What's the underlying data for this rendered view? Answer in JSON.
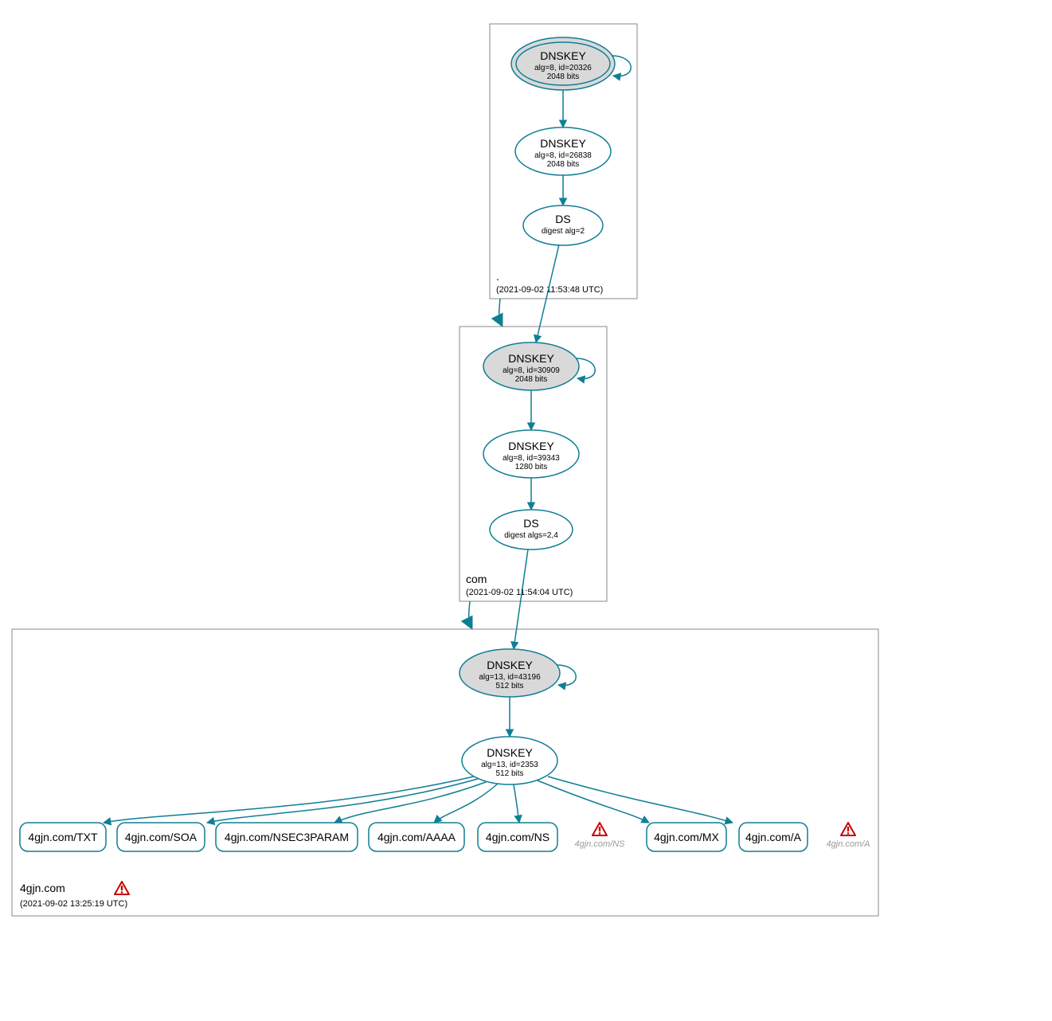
{
  "zones": {
    "root": {
      "name": ".",
      "timestamp": "(2021-09-02 11:53:48 UTC)",
      "ksk": {
        "title": "DNSKEY",
        "line2": "alg=8, id=20326",
        "line3": "2048 bits"
      },
      "zsk": {
        "title": "DNSKEY",
        "line2": "alg=8, id=26838",
        "line3": "2048 bits"
      },
      "ds": {
        "title": "DS",
        "line2": "digest alg=2"
      }
    },
    "com": {
      "name": "com",
      "timestamp": "(2021-09-02 11:54:04 UTC)",
      "ksk": {
        "title": "DNSKEY",
        "line2": "alg=8, id=30909",
        "line3": "2048 bits"
      },
      "zsk": {
        "title": "DNSKEY",
        "line2": "alg=8, id=39343",
        "line3": "1280 bits"
      },
      "ds": {
        "title": "DS",
        "line2": "digest algs=2,4"
      }
    },
    "leaf": {
      "name": "4gjn.com",
      "timestamp": "(2021-09-02 13:25:19 UTC)",
      "ksk": {
        "title": "DNSKEY",
        "line2": "alg=13, id=43196",
        "line3": "512 bits"
      },
      "zsk": {
        "title": "DNSKEY",
        "line2": "alg=13, id=2353",
        "line3": "512 bits"
      }
    }
  },
  "records": {
    "txt": "4gjn.com/TXT",
    "soa": "4gjn.com/SOA",
    "nsec": "4gjn.com/NSEC3PARAM",
    "aaaa": "4gjn.com/AAAA",
    "ns": "4gjn.com/NS",
    "mx": "4gjn.com/MX",
    "a": "4gjn.com/A"
  },
  "ghosts": {
    "ns": "4gjn.com/NS",
    "a": "4gjn.com/A"
  }
}
